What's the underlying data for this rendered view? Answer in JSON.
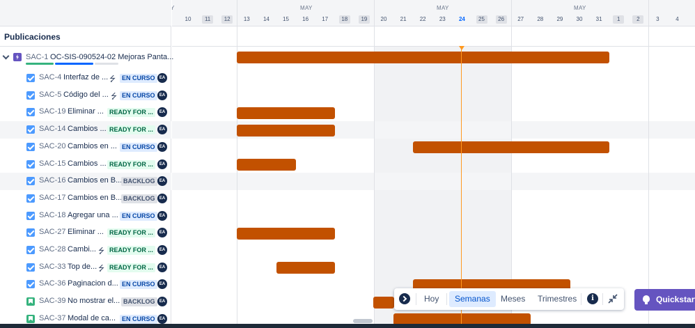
{
  "panel_title": "Publicaciones",
  "timeline": {
    "months": [
      "MAY",
      "MAY",
      "MAY"
    ],
    "week1": [
      "10",
      "11",
      "12",
      "13",
      "14",
      "15",
      "16",
      "17",
      "18",
      "19"
    ],
    "week2": [
      "20",
      "21",
      "22",
      "23",
      "24",
      "25",
      "26"
    ],
    "week3": [
      "27",
      "28",
      "29",
      "30",
      "31",
      "1",
      "2",
      "3",
      "4"
    ],
    "partial_label": "Y",
    "today": "24"
  },
  "epic": {
    "key": "SAC-1",
    "summary": "OC-SIS-090524-02 Mejoras Panta...",
    "colors": {
      "epic": "#6554c0",
      "bar": "#c25100"
    }
  },
  "rows": [
    {
      "key": "SAC-4",
      "summary": "Interfaz de ...",
      "status": "EN CURSO",
      "assignee": "EA"
    },
    {
      "key": "SAC-5",
      "summary": "Código del ...",
      "status": "EN CURSO",
      "assignee": "EA"
    },
    {
      "key": "SAC-19",
      "summary": "Eliminar ...",
      "status": "READY FOR ...",
      "assignee": "EA"
    },
    {
      "key": "SAC-14",
      "summary": "Cambios ...",
      "status": "READY FOR ...",
      "assignee": "EA"
    },
    {
      "key": "SAC-20",
      "summary": "Cambios en ...",
      "status": "EN CURSO",
      "assignee": "EA"
    },
    {
      "key": "SAC-15",
      "summary": "Cambios ...",
      "status": "READY FOR ...",
      "assignee": "EA"
    },
    {
      "key": "SAC-16",
      "summary": "Cambios en B...",
      "status": "BACKLOG",
      "assignee": "EA"
    },
    {
      "key": "SAC-17",
      "summary": "Cambios en B...",
      "status": "BACKLOG",
      "assignee": "EA"
    },
    {
      "key": "SAC-18",
      "summary": "Agregar una ...",
      "status": "EN CURSO",
      "assignee": "EA"
    },
    {
      "key": "SAC-27",
      "summary": "Eliminar ...",
      "status": "READY FOR ...",
      "assignee": "EA"
    },
    {
      "key": "SAC-28",
      "summary": "Cambi...",
      "status": "READY FOR ...",
      "assignee": "EA"
    },
    {
      "key": "SAC-33",
      "summary": "Top de...",
      "status": "READY FOR ...",
      "assignee": "EA"
    },
    {
      "key": "SAC-36",
      "summary": "Paginacion d...",
      "status": "EN CURSO",
      "assignee": "EA"
    },
    {
      "key": "SAC-39",
      "summary": "No mostrar el...",
      "status": "BACKLOG",
      "assignee": "EA"
    },
    {
      "key": "SAC-37",
      "summary": "Modal de ca...",
      "status": "EN CURSO",
      "assignee": "EA"
    }
  ],
  "toolbar": {
    "today": "Hoy",
    "weeks": "Semanas",
    "months": "Meses",
    "quarters": "Trimestres",
    "info_glyph": "i"
  },
  "quickstart": "Quickstart"
}
